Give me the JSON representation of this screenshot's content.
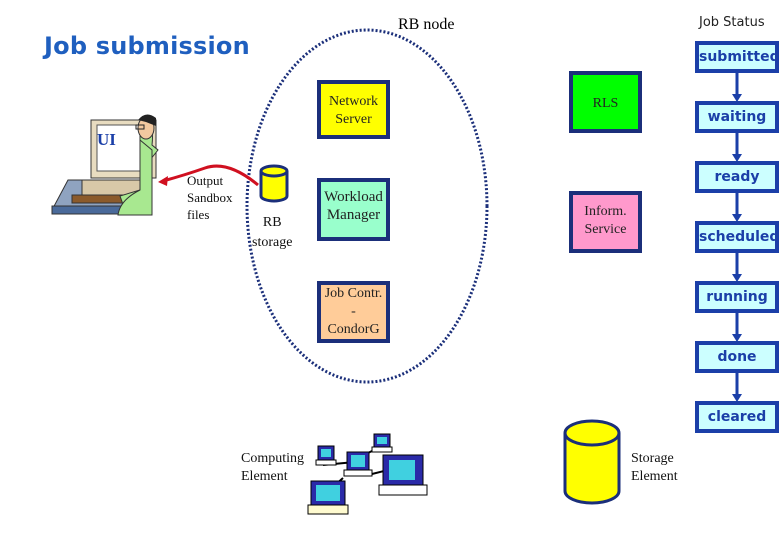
{
  "title": "Job submission",
  "rb_node": {
    "label": "RB node",
    "components": {
      "network_server": {
        "line1": "Network",
        "line2": "Server",
        "color": "#ffff00"
      },
      "workload_manager": {
        "line1": "Workload",
        "line2": "Manager",
        "color": "#99ffcc"
      },
      "job_controller": {
        "line1": "Job Contr.",
        "line2": "-",
        "line3": "CondorG",
        "color": "#ffcc99"
      }
    },
    "storage": {
      "line1": "RB",
      "line2": "storage"
    }
  },
  "external_services": {
    "rls": {
      "label": "RLS",
      "color": "#00ff00"
    },
    "information_service": {
      "line1": "Inform.",
      "line2": "Service",
      "color": "#ff99cc"
    }
  },
  "ui": {
    "label": "UI"
  },
  "flow": {
    "output_sandbox": {
      "line1": "Output",
      "line2": "Sandbox",
      "line3": "files",
      "color": "#d01020"
    }
  },
  "computing_element": {
    "line1": "Computing",
    "line2": "Element"
  },
  "storage_element": {
    "line1": "Storage",
    "line2": "Element"
  },
  "job_status": {
    "title": "Job Status",
    "states": [
      "submitted",
      "waiting",
      "ready",
      "scheduled",
      "running",
      "done",
      "cleared"
    ]
  },
  "colors": {
    "title_blue": "#1f5fbf",
    "box_border": "#1b2f7a",
    "status_fill": "#ccffff",
    "status_border": "#1b3fa8",
    "cylinder_fill": "#ffff00"
  }
}
